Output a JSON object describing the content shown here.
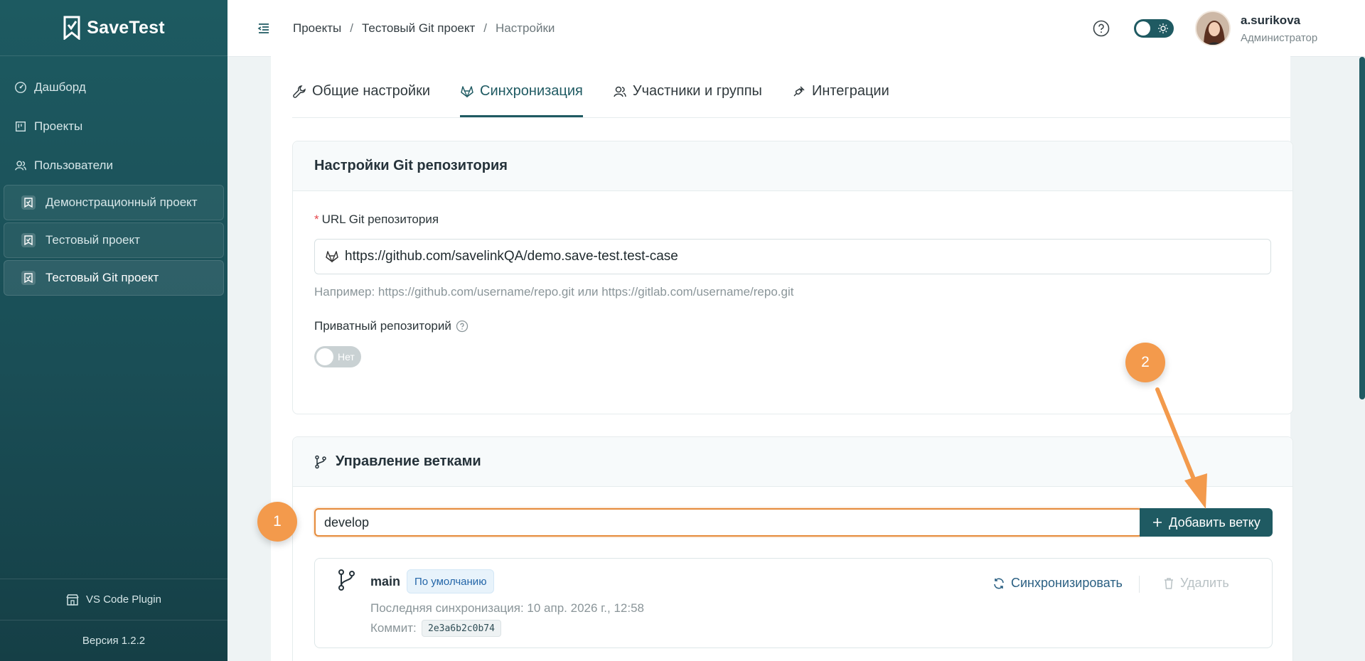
{
  "app": {
    "brand": "SaveTest"
  },
  "sidebar": {
    "nav": [
      {
        "label": "Дашборд",
        "icon": "dashboard-icon"
      },
      {
        "label": "Проекты",
        "icon": "projects-icon"
      },
      {
        "label": "Пользователи",
        "icon": "users-icon"
      }
    ],
    "projects": [
      {
        "label": "Демонстрационный проект"
      },
      {
        "label": "Тестовый проект"
      },
      {
        "label": "Тестовый Git проект",
        "active": true
      }
    ],
    "plugin_label": "VS Code Plugin",
    "version_label": "Версия 1.2.2"
  },
  "header": {
    "breadcrumb": [
      "Проекты",
      "Тестовый Git проект",
      "Настройки"
    ],
    "breadcrumb_separator": "/",
    "user_name": "a.surikova",
    "user_role": "Администратор"
  },
  "tabs": [
    {
      "label": "Общие настройки",
      "icon": "wrench-icon"
    },
    {
      "label": "Синхронизация",
      "icon": "gitlab-icon",
      "active": true
    },
    {
      "label": "Участники и группы",
      "icon": "users-icon"
    },
    {
      "label": "Интеграции",
      "icon": "plug-icon"
    }
  ],
  "git_settings": {
    "title": "Настройки Git репозитория",
    "url_label": "URL Git репозитория",
    "required_mark": "*",
    "url_value": "https://github.com/savelinkQA/demo.save-test.test-case",
    "url_hint": "Например: https://github.com/username/repo.git или https://gitlab.com/username/repo.git",
    "private_label": "Приватный репозиторий",
    "private_toggle_text": "Нет",
    "private_enabled": false
  },
  "branches": {
    "title": "Управление ветками",
    "input_value": "develop",
    "add_button_label": "Добавить ветку",
    "items": [
      {
        "name": "main",
        "badge": "По умолчанию",
        "last_sync": "Последняя синхронизация: 10 апр. 2026 г., 12:58",
        "commit_label": "Коммит:",
        "commit": "2e3a6b2c0b74",
        "sync_label": "Синхронизировать",
        "delete_label": "Удалить"
      }
    ]
  },
  "annotations": {
    "marker_1": "1",
    "marker_2": "2"
  },
  "colors": {
    "primary": "#1f5a62",
    "accent": "#f39a4c",
    "link": "#2a5f82"
  }
}
